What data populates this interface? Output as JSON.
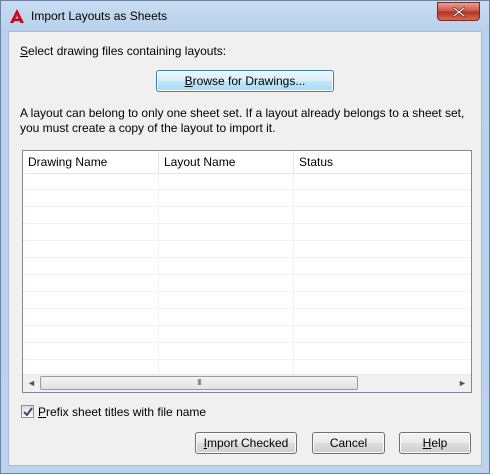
{
  "window": {
    "title": "Import Layouts as Sheets",
    "app_icon": "autocad-a-icon",
    "close_icon": "close-icon"
  },
  "main": {
    "select_label_prefix": "S",
    "select_label_rest": "elect drawing files containing layouts:",
    "browse_button_prefix": "B",
    "browse_button_rest": "rowse for Drawings...",
    "info_text": "A layout can belong to only one sheet set. If a layout already belongs to a sheet set, you must create a copy of the layout to import it."
  },
  "table": {
    "columns": [
      "Drawing Name",
      "Layout Name",
      "Status"
    ],
    "rows": [],
    "scroll_left": "◄",
    "scroll_right": "►",
    "thumb_grip": "III"
  },
  "options": {
    "prefix_checkbox_checked": true,
    "prefix_label_prefix": "P",
    "prefix_label_rest": "refix sheet titles with file name"
  },
  "buttons": {
    "import_prefix": "I",
    "import_rest": "mport Checked",
    "cancel": "Cancel",
    "help_prefix": "H",
    "help_rest": "elp"
  }
}
